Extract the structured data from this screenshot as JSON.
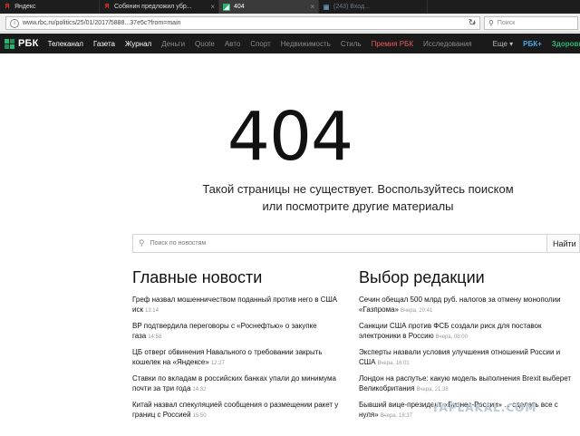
{
  "tabs": [
    {
      "icon": "yandex-icon",
      "label": "Яндекс",
      "active": false
    },
    {
      "icon": "yandex-icon",
      "label": "Собянин предложил убр...",
      "active": false
    },
    {
      "icon": "rbc-icon",
      "label": "404",
      "active": true
    },
    {
      "icon": "vk-icon",
      "label": "(243) Вход...",
      "active": false
    }
  ],
  "address": {
    "url": "www.rbc.ru/politics/25/01/2017/5888...37e5c?from=main",
    "search_placeholder": "Поиск"
  },
  "nav": {
    "logo": "РБК",
    "items": [
      {
        "label": "Телеканал",
        "style": "normal"
      },
      {
        "label": "Газета",
        "style": "normal"
      },
      {
        "label": "Журнал",
        "style": "normal"
      },
      {
        "label": "Деньги",
        "style": "dim"
      },
      {
        "label": "Quote",
        "style": "dim"
      },
      {
        "label": "Авто",
        "style": "dim"
      },
      {
        "label": "Спорт",
        "style": "dim"
      },
      {
        "label": "Недвижимость",
        "style": "dim"
      },
      {
        "label": "Стиль",
        "style": "dim"
      },
      {
        "label": "Премия РБК",
        "style": "premium"
      },
      {
        "label": "Исследования",
        "style": "dim"
      }
    ],
    "more": "Еще ▾",
    "rbc_plus": "РБК+",
    "health": "Здоровье"
  },
  "error": {
    "code": "404",
    "line1": "Такой страницы не существует. Воспользуйтесь поиском",
    "line2": "или посмотрите другие материалы"
  },
  "search": {
    "placeholder": "Поиск по новостям",
    "button": "Найти"
  },
  "main_news": {
    "title": "Главные новости",
    "items": [
      {
        "text": "Греф назвал мошенничеством поданный против него в США иск",
        "time": "13:14"
      },
      {
        "text": "BP подтвердила переговоры с «Роснефтью» о закупке газа",
        "time": "14:58"
      },
      {
        "text": "ЦБ отверг обвинения Навального о требовании закрыть кошелек на «Яндексе»",
        "time": "12:27"
      },
      {
        "text": "Ставки по вкладам в российских банках упали до минимума почти за три года",
        "time": "14:32"
      },
      {
        "text": "Китай назвал спекуляцией сообщения о размещении ракет у границ с Россией",
        "time": "15:50"
      }
    ]
  },
  "editors_choice": {
    "title": "Выбор редакции",
    "items": [
      {
        "text": "Сечин обещал 500 млрд руб. налогов за отмену монополии «Газпрома»",
        "time": "Вчера, 20:41"
      },
      {
        "text": "Санкции США против ФСБ создали риск для поставок электроники в Россию",
        "time": "Вчера, 08:00"
      },
      {
        "text": "Эксперты назвали условия улучшения отношений России и США",
        "time": "Вчера, 16:01"
      },
      {
        "text": "Лондон на распутье: какую модель выполнения Brexit выберет Великобритания",
        "time": "Вчера, 21:38"
      },
      {
        "text": "Бывший вице-президент «Бизнес-России» ... сделать все с нуля»",
        "time": "Вчера, 18:37"
      }
    ]
  },
  "watermark": "YAPLAKAL.COM"
}
